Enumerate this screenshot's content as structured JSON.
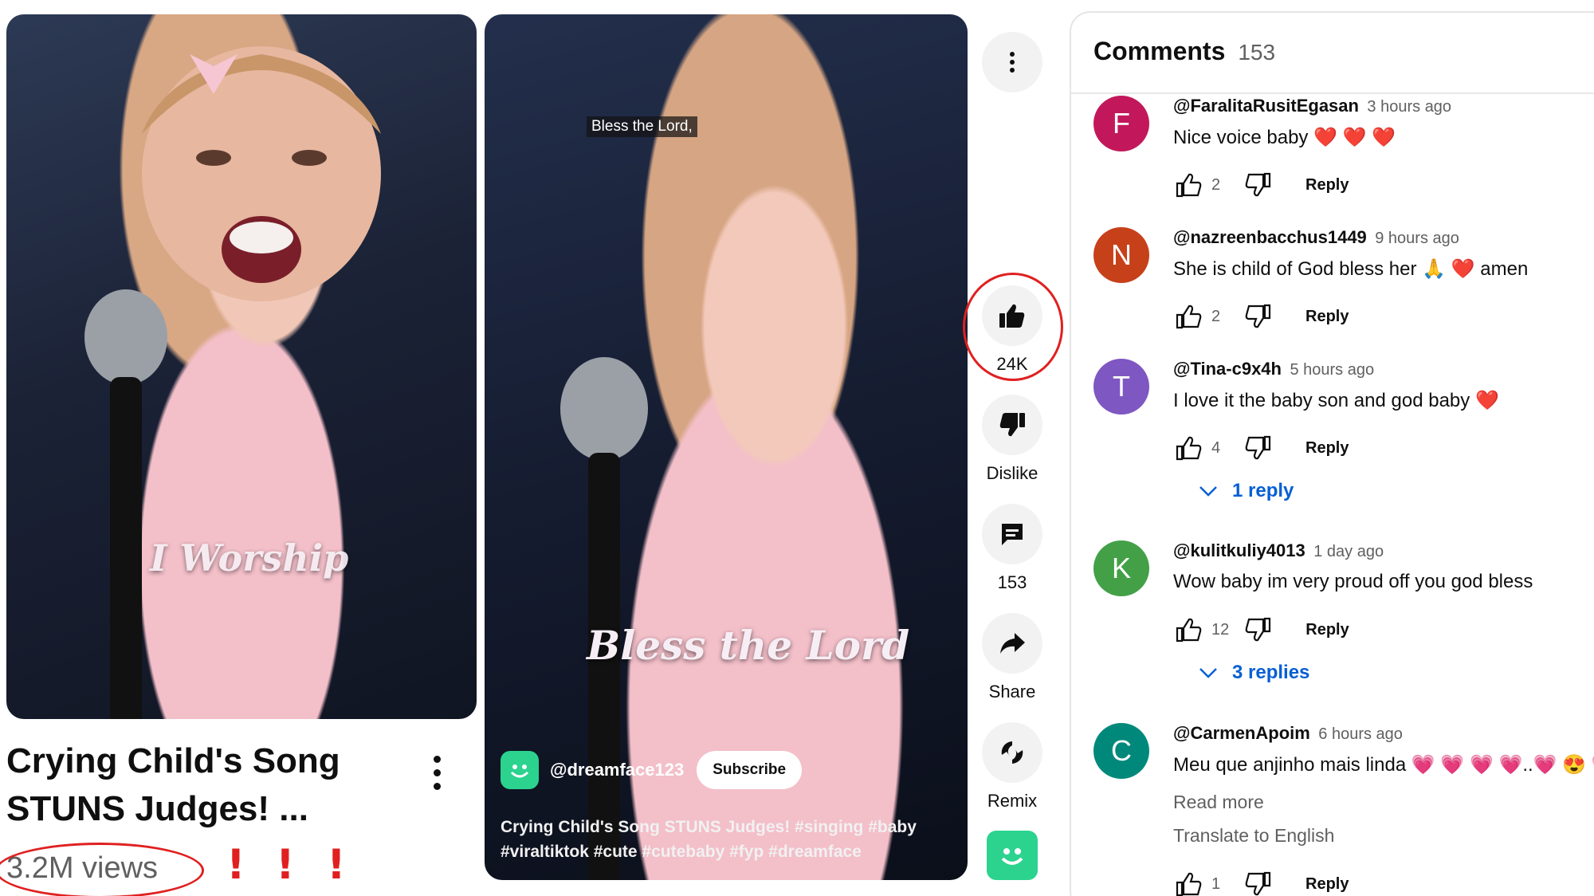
{
  "left_card": {
    "overlay_text": "I Worship",
    "title": "Crying Child's Song STUNS Judges! ...",
    "views": "3.2M views",
    "exclamations": [
      "!",
      "!",
      "!"
    ]
  },
  "video": {
    "caption_top": "Bless the Lord,",
    "overlay_text": "Bless the Lord",
    "channel": "@dreamface123",
    "subscribe_label": "Subscribe",
    "description_line1": "Crying Child's Song STUNS Judges! #singing #baby",
    "description_line2": "#viraltiktok #cute #cutebaby #fyp #dreamface"
  },
  "actions": {
    "like_count": "24K",
    "dislike_label": "Dislike",
    "comments_count": "153",
    "share_label": "Share",
    "remix_label": "Remix",
    "exclamations": [
      "!",
      "!",
      "!"
    ]
  },
  "comments": {
    "title": "Comments",
    "count": "153",
    "items": [
      {
        "initial": "F",
        "avatar_color": "#c2185b",
        "author": "@FaralitaRusitEgasan",
        "time": "3 hours ago",
        "text": "Nice voice baby ❤️ ❤️ ❤️",
        "likes": "2",
        "reply": "Reply"
      },
      {
        "initial": "N",
        "avatar_color": "#c6401a",
        "author": "@nazreenbacchus1449",
        "time": "9 hours ago",
        "text": "She is child of God bless her 🙏 ❤️ amen",
        "likes": "2",
        "reply": "Reply"
      },
      {
        "initial": "T",
        "avatar_color": "#7e57c2",
        "author": "@Tina-c9x4h",
        "time": "5 hours ago",
        "text": "I love it the baby son and god baby ❤️",
        "likes": "4",
        "reply": "Reply",
        "replies": "1 reply"
      },
      {
        "initial": "K",
        "avatar_color": "#43a047",
        "author": "@kulitkuliy4013",
        "time": "1 day ago",
        "text": "Wow baby im very proud off you god bless",
        "likes": "12",
        "reply": "Reply",
        "replies": "3 replies"
      },
      {
        "initial": "C",
        "avatar_color": "#00897b",
        "author": "@CarmenApoim",
        "time": "6 hours ago",
        "text": "Meu que anjinho mais linda 💗 💗 💗 💗..💗 😍 💗",
        "likes": "1",
        "reply": "Reply",
        "read_more": "Read more",
        "translate": "Translate to English"
      }
    ]
  }
}
